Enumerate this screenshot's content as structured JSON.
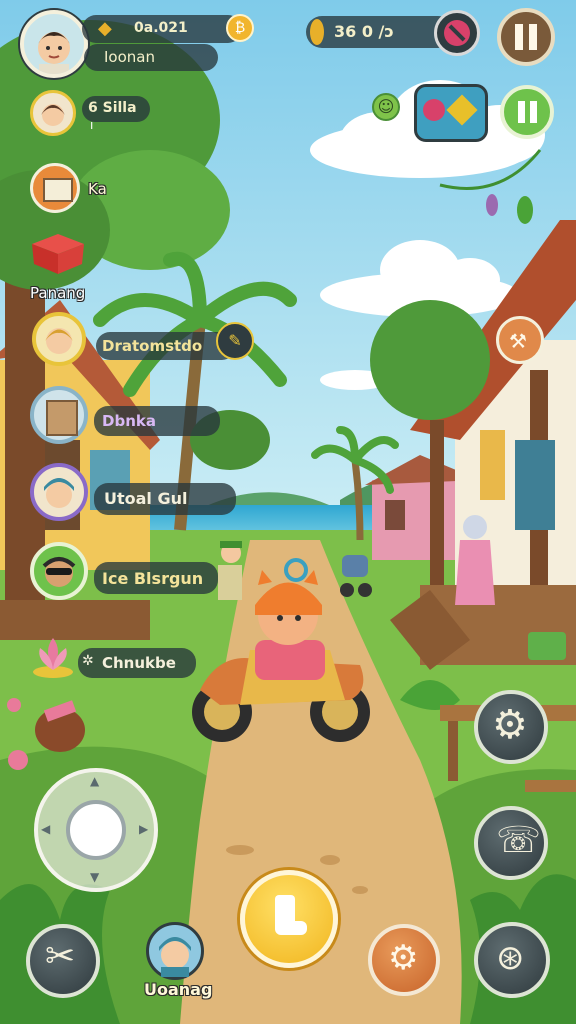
{
  "colors": {
    "sky": "#8fd3ef",
    "grass": "#7dbf4a",
    "path": "#e0b77a",
    "sea": "#3fb4d6",
    "pill": "#2f3c40",
    "accent_yellow": "#f5c518",
    "accent_green": "#6ec24b"
  },
  "hud": {
    "player_name": "Ioonan",
    "coins_value": "0a.021",
    "resource_value": "36 0 /ɔ",
    "icons": {
      "coin": "golden-leaf-icon",
      "gem": "yellow-gem-icon",
      "resource": "leaf-icon",
      "blocked": "no-entry-icon",
      "pause": "pause-icon",
      "emote": "smiley-icon",
      "shop": "gem-bundle-icon",
      "side_pause": "pause-icon-green"
    }
  },
  "side_menu": {
    "items": [
      {
        "label": "6 Silla",
        "sub": "ı",
        "icon": "character-portrait-icon"
      },
      {
        "label": "Ka",
        "icon": "map-scroll-icon"
      },
      {
        "label": "Panang",
        "icon": "red-chest-icon"
      },
      {
        "label": "Dratomstdo",
        "icon": "character-portrait-icon"
      },
      {
        "label": "Dbnka",
        "icon": "notebook-icon"
      },
      {
        "label": "Utoal Gul",
        "icon": "character-portrait-icon"
      },
      {
        "label": "Ice Blsrgun",
        "icon": "sunglasses-portrait-icon"
      },
      {
        "label": "Chnukbe",
        "icon": "lotus-flower-icon"
      }
    ]
  },
  "bottom": {
    "avatar_label": "Uoanag",
    "icons": {
      "left": "crossed-tools-icon",
      "center": "boot-icon",
      "right1": "gear-box-icon",
      "right2": "compass-icon",
      "side1": "settings-gear-icon",
      "side2": "phone-icon",
      "side3": "hammer-icon",
      "joystick": "joystick-icon"
    }
  }
}
